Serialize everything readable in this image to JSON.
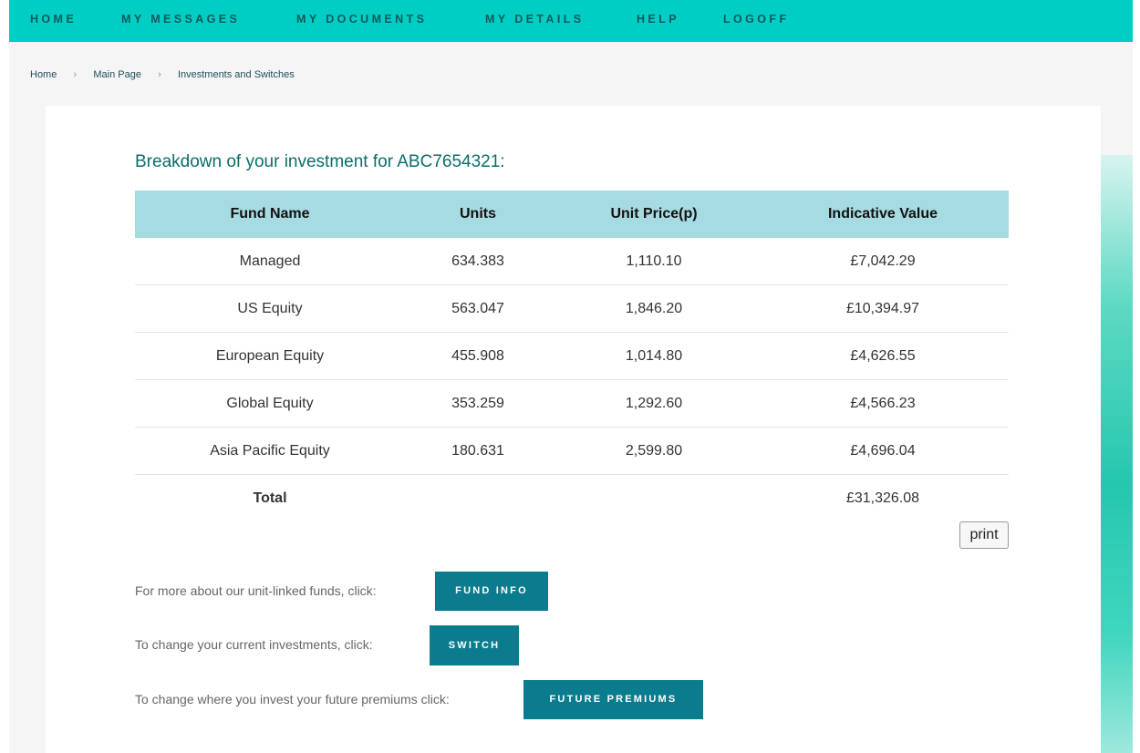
{
  "nav": {
    "items": [
      {
        "label": "HOME"
      },
      {
        "label": "MY MESSAGES"
      },
      {
        "label": "MY DOCUMENTS"
      },
      {
        "label": "MY DETAILS"
      },
      {
        "label": "HELP"
      },
      {
        "label": "LOGOFF"
      }
    ]
  },
  "breadcrumb": {
    "items": [
      "Home",
      "Main Page",
      "Investments and Switches"
    ],
    "separator": "›"
  },
  "main": {
    "title": "Breakdown of your investment for ABC7654321:",
    "table": {
      "headers": [
        "Fund Name",
        "Units",
        "Unit Price(p)",
        "Indicative Value"
      ],
      "rows": [
        {
          "fund": "Managed",
          "units": "634.383",
          "price": "1,110.10",
          "value": "£7,042.29"
        },
        {
          "fund": "US Equity",
          "units": "563.047",
          "price": "1,846.20",
          "value": "£10,394.97"
        },
        {
          "fund": "European Equity",
          "units": "455.908",
          "price": "1,014.80",
          "value": "£4,626.55"
        },
        {
          "fund": "Global Equity",
          "units": "353.259",
          "price": "1,292.60",
          "value": "£4,566.23"
        },
        {
          "fund": "Asia Pacific Equity",
          "units": "180.631",
          "price": "2,599.80",
          "value": "£4,696.04"
        }
      ],
      "total_label": "Total",
      "total_value": "£31,326.08"
    },
    "print_label": "print",
    "actions": [
      {
        "text": "For more about our unit-linked funds, click:",
        "button": "FUND INFO"
      },
      {
        "text": "To change your current investments, click:",
        "button": "SWITCH"
      },
      {
        "text": "To change where you invest your future premiums click:",
        "button": "FUTURE PREMIUMS"
      }
    ]
  },
  "colors": {
    "nav_bg": "#00cec4",
    "header_bg": "#a6dbe2",
    "button_bg": "#0b7b8e",
    "title": "#0b6e6a",
    "link": "#1a7c8c"
  }
}
